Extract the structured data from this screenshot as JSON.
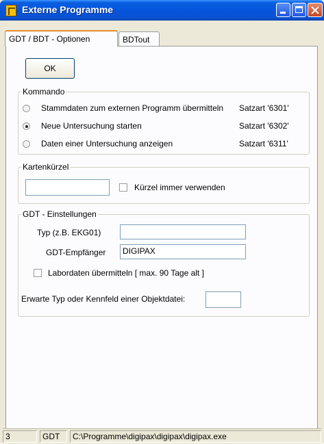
{
  "window": {
    "title": "Externe Programme"
  },
  "tabs": [
    {
      "label": "GDT / BDT - Optionen",
      "active": true
    },
    {
      "label": "BDTout",
      "active": false
    }
  ],
  "ok_button": {
    "label": "OK"
  },
  "kommando": {
    "label": "Kommando",
    "options": [
      {
        "label": "Stammdaten zum externen Programm übermitteln",
        "satzart": "Satzart '6301'",
        "selected": false
      },
      {
        "label": "Neue Untersuchung starten",
        "satzart": "Satzart '6302'",
        "selected": true
      },
      {
        "label": "Daten einer Untersuchung anzeigen",
        "satzart": "Satzart '6311'",
        "selected": false
      }
    ]
  },
  "kartenkuerzel": {
    "label": "Kartenkürzel",
    "input_value": "",
    "checkbox_label": "Kürzel immer verwenden",
    "checked": false
  },
  "gdt": {
    "label": "GDT - Einstellungen",
    "typ_label": "Typ (z.B. EKG01)",
    "typ_value": "",
    "empfaenger_label": "GDT-Empfänger",
    "empfaenger_value": "DIGIPAX",
    "labordaten_label": "Labordaten übermitteln  [ max. 90 Tage alt ]",
    "labordaten_checked": false,
    "objekt_label": "Erwarte Typ oder Kennfeld einer Objektdatei:",
    "objekt_value": ""
  },
  "statusbar": {
    "cell1": "3",
    "cell2": "GDT",
    "cell3": "C:\\Programme\\digipax\\digipax\\digipax.exe"
  }
}
